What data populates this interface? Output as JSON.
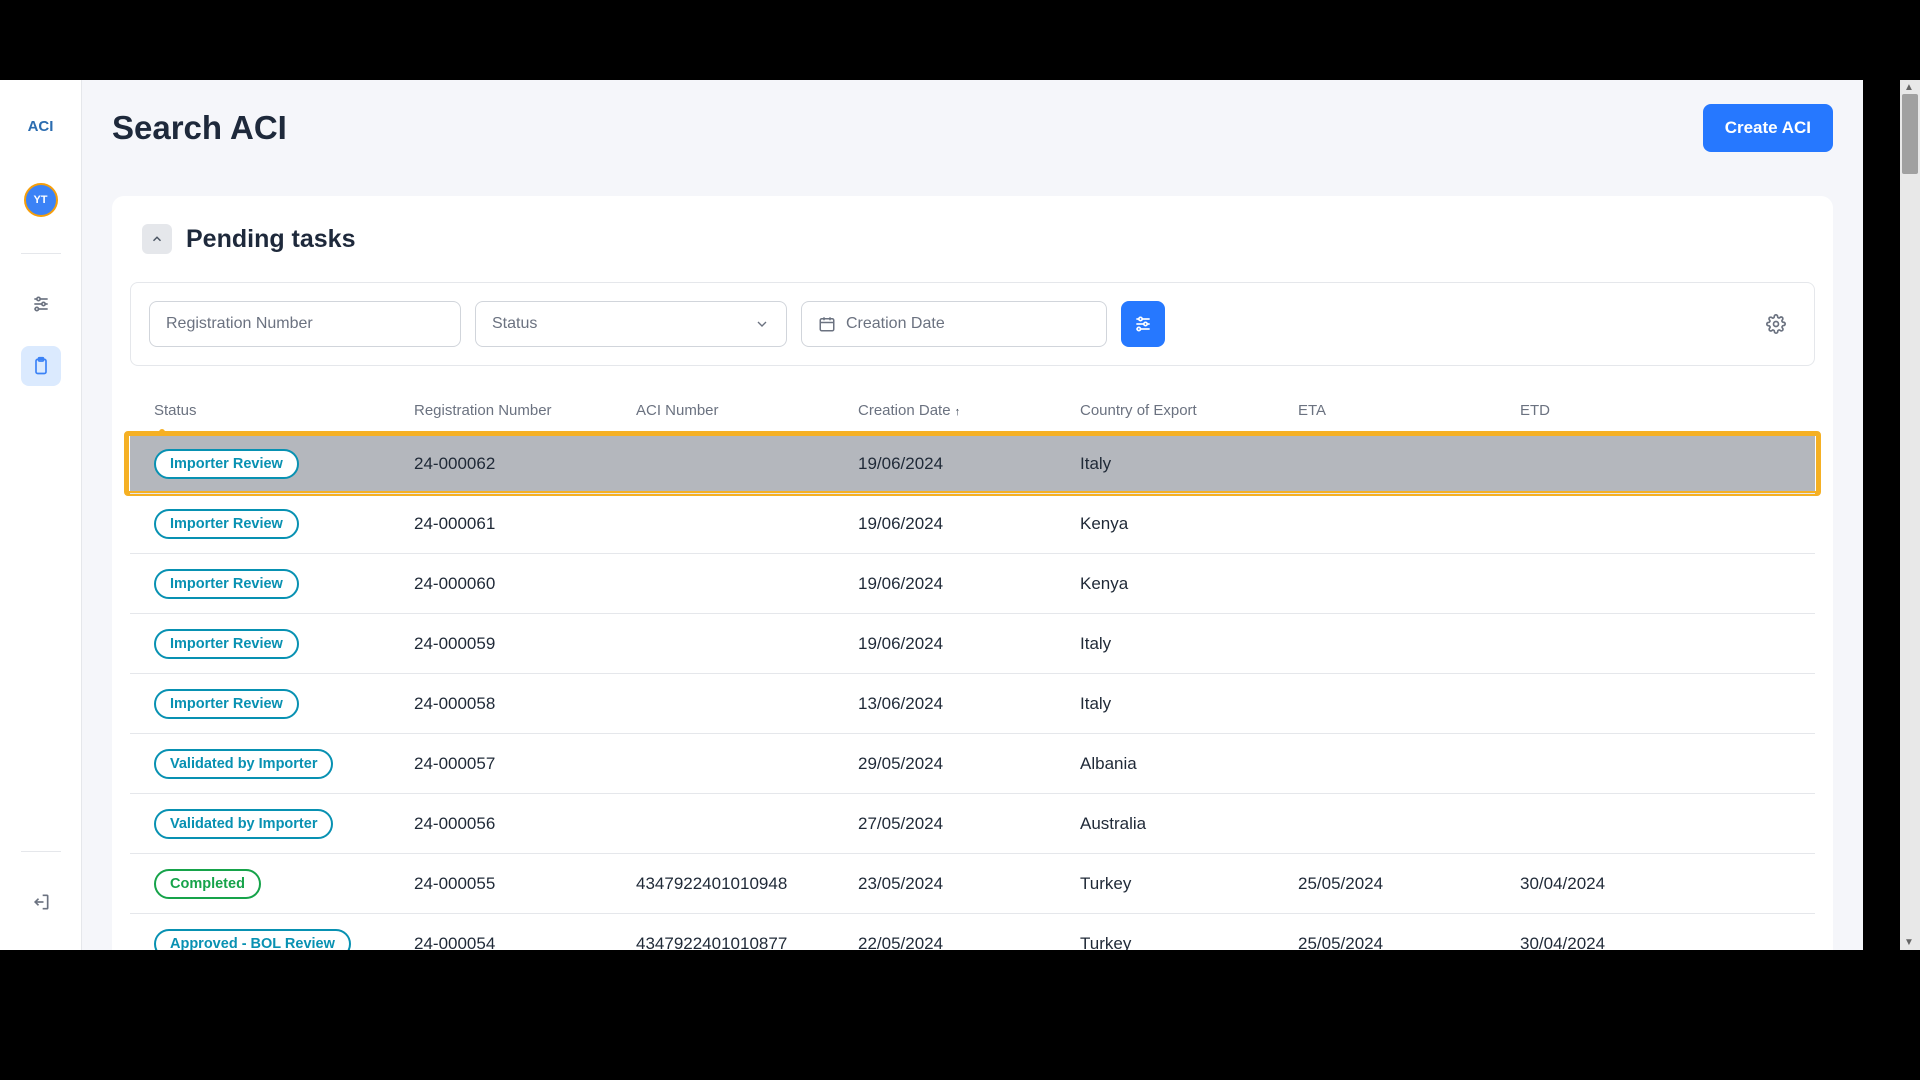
{
  "sidebar": {
    "logo": "ACI",
    "avatar_initials": "YT"
  },
  "header": {
    "page_title": "Search ACI",
    "create_button": "Create ACI"
  },
  "card": {
    "title": "Pending tasks"
  },
  "filters": {
    "registration_placeholder": "Registration Number",
    "status_placeholder": "Status",
    "date_placeholder": "Creation Date"
  },
  "table": {
    "columns": {
      "status": "Status",
      "registration_number": "Registration Number",
      "aci_number": "ACI Number",
      "creation_date": "Creation Date",
      "country_of_export": "Country of Export",
      "eta": "ETA",
      "etd": "ETD"
    },
    "sort_indicator": "↑",
    "rows": [
      {
        "status": "Importer Review",
        "status_color": "#0891b2",
        "registration": "24-000062",
        "aci": "",
        "date": "19/06/2024",
        "country": "Italy",
        "eta": "",
        "etd": "",
        "highlighted": true
      },
      {
        "status": "Importer Review",
        "status_color": "#0891b2",
        "registration": "24-000061",
        "aci": "",
        "date": "19/06/2024",
        "country": "Kenya",
        "eta": "",
        "etd": ""
      },
      {
        "status": "Importer Review",
        "status_color": "#0891b2",
        "registration": "24-000060",
        "aci": "",
        "date": "19/06/2024",
        "country": "Kenya",
        "eta": "",
        "etd": ""
      },
      {
        "status": "Importer Review",
        "status_color": "#0891b2",
        "registration": "24-000059",
        "aci": "",
        "date": "19/06/2024",
        "country": "Italy",
        "eta": "",
        "etd": ""
      },
      {
        "status": "Importer Review",
        "status_color": "#0891b2",
        "registration": "24-000058",
        "aci": "",
        "date": "13/06/2024",
        "country": "Italy",
        "eta": "",
        "etd": ""
      },
      {
        "status": "Validated by Importer",
        "status_color": "#0891b2",
        "registration": "24-000057",
        "aci": "",
        "date": "29/05/2024",
        "country": "Albania",
        "eta": "",
        "etd": ""
      },
      {
        "status": "Validated by Importer",
        "status_color": "#0891b2",
        "registration": "24-000056",
        "aci": "",
        "date": "27/05/2024",
        "country": "Australia",
        "eta": "",
        "etd": ""
      },
      {
        "status": "Completed",
        "status_color": "#16a34a",
        "registration": "24-000055",
        "aci": "4347922401010948",
        "date": "23/05/2024",
        "country": "Turkey",
        "eta": "25/05/2024",
        "etd": "30/04/2024"
      },
      {
        "status": "Approved - BOL Review",
        "status_color": "#0891b2",
        "registration": "24-000054",
        "aci": "4347922401010877",
        "date": "22/05/2024",
        "country": "Turkey",
        "eta": "25/05/2024",
        "etd": "30/04/2024"
      }
    ]
  }
}
